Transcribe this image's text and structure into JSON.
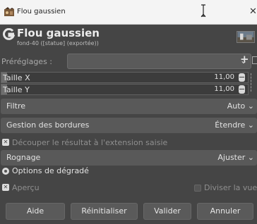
{
  "window": {
    "title": "Flou gaussien"
  },
  "header": {
    "title": "Flou gaussien",
    "subtitle": "fond-40 ([statue] (exportée))"
  },
  "presets": {
    "label": "Préréglages :",
    "value": ""
  },
  "size": [
    {
      "label": "Taille X",
      "value": "11,00"
    },
    {
      "label": "Taille Y",
      "value": "11,00"
    }
  ],
  "filter": {
    "label": "Filtre",
    "value": "Auto"
  },
  "border": {
    "label": "Gestion des bordures",
    "value": "Étendre"
  },
  "clip": {
    "label": "Découper le résultat à l'extension saisie",
    "checked": true
  },
  "crop": {
    "label": "Rognage",
    "value": "Ajuster"
  },
  "gradient": {
    "label": "Options de dégradé"
  },
  "preview": {
    "label": "Aperçu",
    "checked": true
  },
  "split": {
    "label": "Diviser la vue",
    "checked": false
  },
  "buttons": {
    "help": "Aide",
    "reset": "Réinitialiser",
    "ok": "Valider",
    "cancel": "Annuler"
  },
  "icons": {
    "app": "gimp-app-icon",
    "logo": "gimp-logo-icon",
    "close": "close-icon",
    "combo": "chevron-down-icon",
    "add": "plus-icon",
    "menu": "menu-icon",
    "spinner": "spin-arrows-icon",
    "chain": "chain-icon",
    "check": "checkmark-icon"
  },
  "colors": {
    "background": "#454545",
    "titlebar": "#f4f4f4",
    "field": "#595959"
  }
}
